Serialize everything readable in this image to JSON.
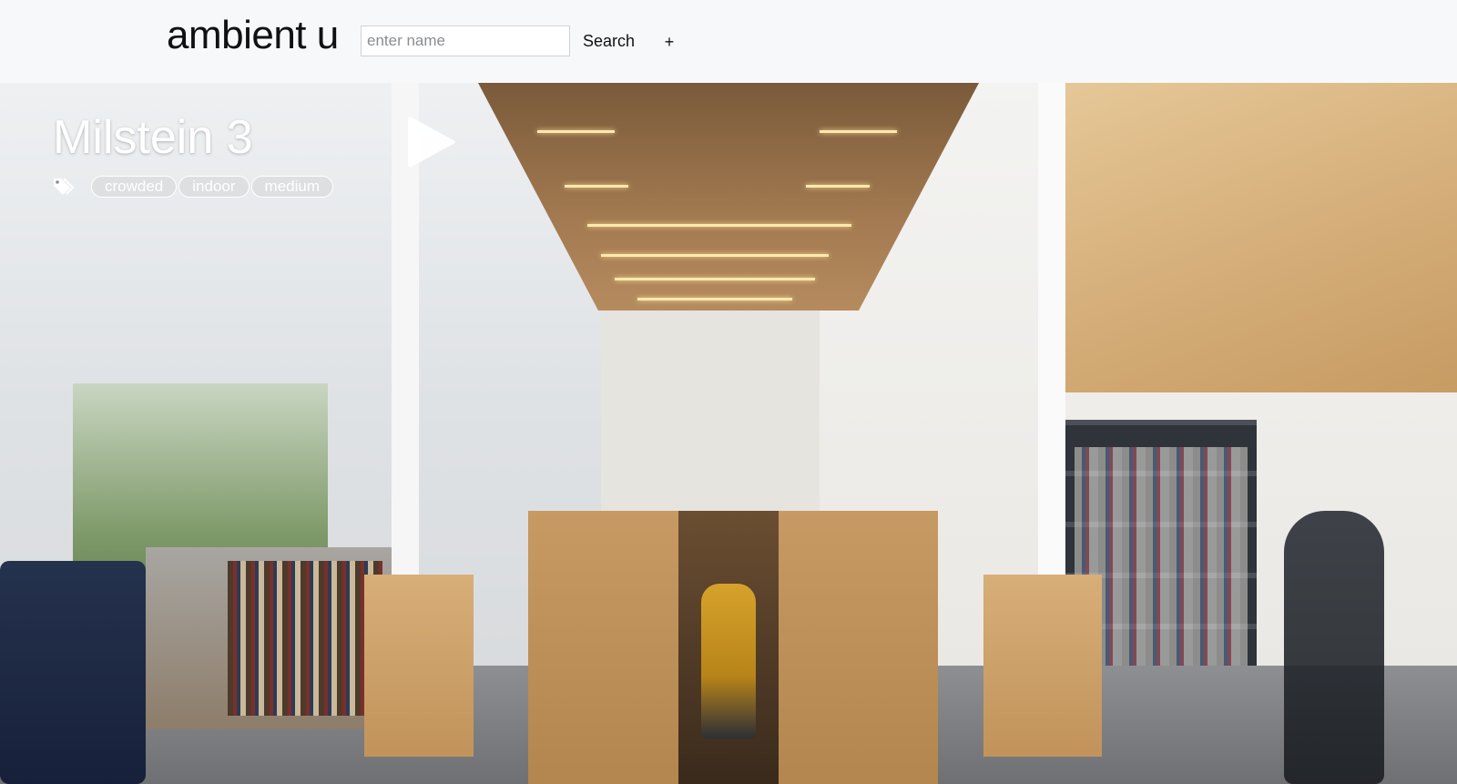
{
  "header": {
    "brand": "ambient u",
    "search": {
      "placeholder": "enter name",
      "value": ""
    },
    "search_label": "Search",
    "add_label": "+"
  },
  "place": {
    "title": "Milstein 3",
    "play_icon": "play-icon",
    "tag_icon": "tags-icon",
    "tags": [
      "crowded",
      "indoor",
      "medium"
    ]
  },
  "colors": {
    "header_bg": "#f7f8fa",
    "overlay_text": "#ffffff"
  }
}
